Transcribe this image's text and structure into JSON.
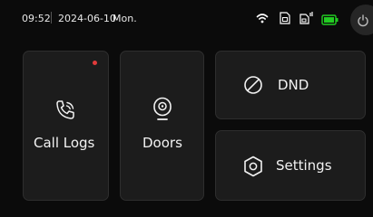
{
  "status_bar": {
    "time": "09:52",
    "date": "2024-06-10",
    "weekday": "Mon.",
    "icons": [
      "wifi-icon",
      "sd-card-icon",
      "sim-card-icon",
      "battery-icon"
    ],
    "battery_color": "#22cc22"
  },
  "tiles": {
    "call_logs": {
      "label": "Call Logs",
      "icon": "phone-icon",
      "has_notification": true,
      "badge_color": "#e23b3b"
    },
    "doors": {
      "label": "Doors",
      "icon": "door-camera-icon"
    },
    "dnd": {
      "label": "DND",
      "icon": "dnd-icon"
    },
    "settings": {
      "label": "Settings",
      "icon": "settings-icon"
    }
  },
  "power_button": {
    "icon": "power-icon"
  }
}
